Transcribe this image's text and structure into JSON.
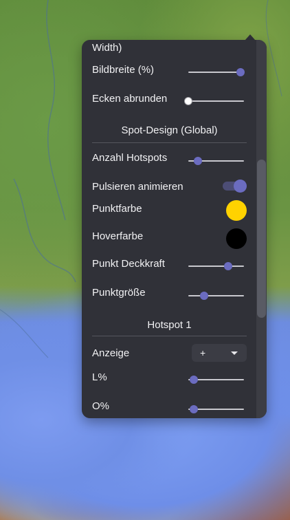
{
  "panel": {
    "width_label": "Width)",
    "rows": {
      "bildbreite": {
        "label": "Bildbreite (%)",
        "value": 0.94
      },
      "ecken": {
        "label": "Ecken abrunden",
        "value": 0.0
      }
    },
    "spot_design": {
      "title": "Spot-Design (Global)",
      "anzahl": {
        "label": "Anzahl Hotspots",
        "value": 0.17
      },
      "pulsieren": {
        "label": "Pulsieren animieren",
        "on": true
      },
      "punktfarbe": {
        "label": "Punktfarbe",
        "color": "#ffd200"
      },
      "hoverfarbe": {
        "label": "Hoverfarbe",
        "color": "#000000"
      },
      "deckkraft": {
        "label": "Punkt Deckkraft",
        "value": 0.72
      },
      "groesse": {
        "label": "Punktgröße",
        "value": 0.28
      }
    },
    "hotspot": {
      "title": "Hotspot 1",
      "anzeige": {
        "label": "Anzeige",
        "value": "+"
      },
      "l": {
        "label": "L%",
        "value": 0.1
      },
      "o": {
        "label": "O%",
        "value": 0.1
      }
    }
  },
  "colors": {
    "panel": "#303138",
    "accent": "#6b6cc0",
    "text": "#f2f2f4"
  }
}
